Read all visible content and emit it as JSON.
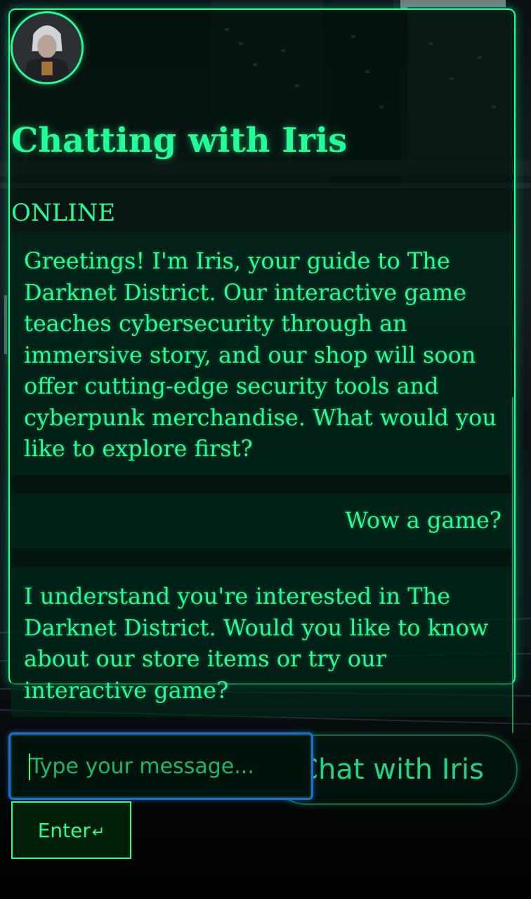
{
  "header": {
    "title": "Chatting with Iris",
    "status": "ONLINE",
    "avatar_icon": "iris-avatar-icon"
  },
  "messages": [
    {
      "sender": "bot",
      "text": "Greetings! I'm Iris, your guide to The Darknet District. Our interactive game teaches cybersecurity through an immersive story, and our shop will soon offer cutting-edge security tools and cyberpunk merchandise. What would you like to explore first?"
    },
    {
      "sender": "user",
      "text": "Wow a game?"
    },
    {
      "sender": "bot",
      "text": "I understand you're interested in The Darknet District. Would you like to know about our store items or try our interactive game?"
    }
  ],
  "composer": {
    "placeholder": "Type your message...",
    "value": "",
    "enter_label": "Enter",
    "enter_icon": "↵",
    "chat_button_label": "Chat with Iris"
  },
  "colors": {
    "accent": "#22ff99",
    "focus_ring": "#1e6fd6",
    "background": "#000000"
  }
}
